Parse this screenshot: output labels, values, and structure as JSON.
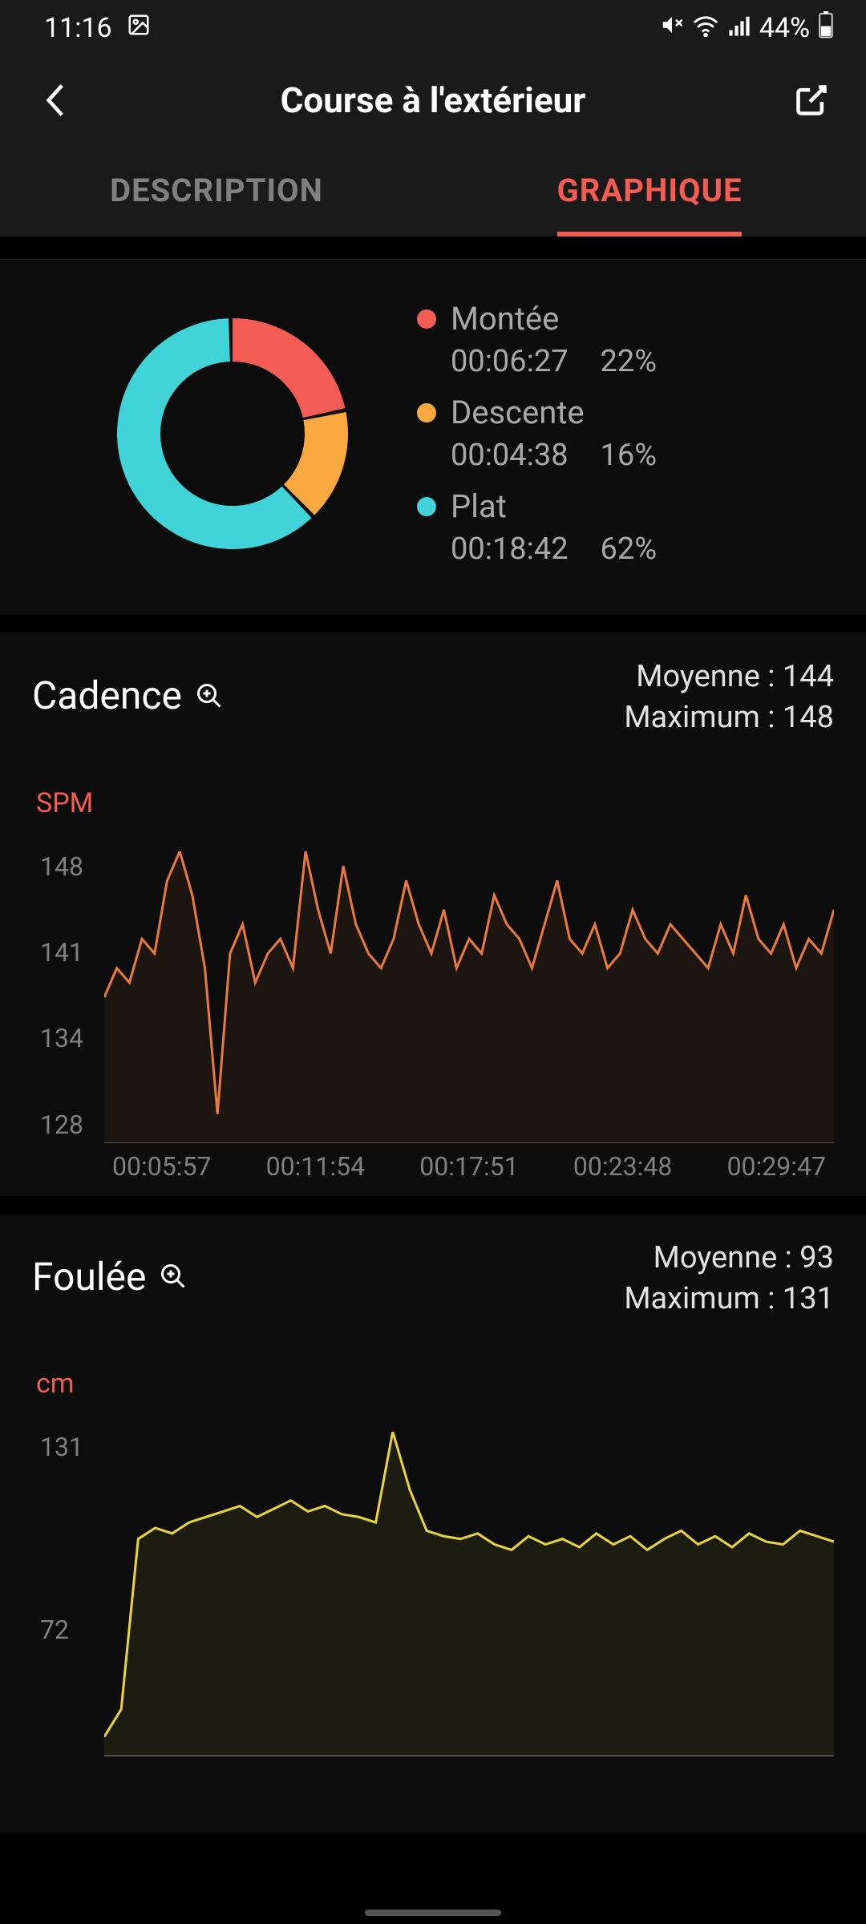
{
  "status_bar": {
    "time": "11:16",
    "battery": "44%"
  },
  "header": {
    "title": "Course à l'extérieur"
  },
  "tabs": {
    "description": "DESCRIPTION",
    "graphique": "GRAPHIQUE"
  },
  "colors": {
    "accent": "#f25c54",
    "montee": "#f25c54",
    "descente": "#f7a83e",
    "plat": "#40d3d8",
    "cadence_line": "#e87a3e",
    "foulee_line": "#e8d43e"
  },
  "donut": {
    "items": [
      {
        "name": "Montée",
        "time": "00:06:27",
        "pct": "22%",
        "value": 22,
        "color": "#f25c54"
      },
      {
        "name": "Descente",
        "time": "00:04:38",
        "pct": "16%",
        "value": 16,
        "color": "#f7a83e"
      },
      {
        "name": "Plat",
        "time": "00:18:42",
        "pct": "62%",
        "value": 62,
        "color": "#40d3d8"
      }
    ]
  },
  "cadence": {
    "title": "Cadence",
    "unit": "SPM",
    "avg_label": "Moyenne : 144",
    "max_label": "Maximum : 148",
    "ylabels": [
      "148",
      "141",
      "134",
      "128"
    ],
    "xlabels": [
      "00:05:57",
      "00:11:54",
      "00:17:51",
      "00:23:48",
      "00:29:47"
    ]
  },
  "foulee": {
    "title": "Foulée",
    "unit": "cm",
    "avg_label": "Moyenne : 93",
    "max_label": "Maximum : 131",
    "ylabels": [
      "131",
      "72"
    ]
  },
  "chart_data": [
    {
      "type": "pie",
      "title": "Terrain breakdown",
      "series": [
        {
          "name": "Montée",
          "value": 22,
          "time": "00:06:27"
        },
        {
          "name": "Descente",
          "value": 16,
          "time": "00:04:38"
        },
        {
          "name": "Plat",
          "value": 62,
          "time": "00:18:42"
        }
      ]
    },
    {
      "type": "line",
      "title": "Cadence",
      "ylabel": "SPM",
      "ylim": [
        128,
        148
      ],
      "xticks": [
        "00:05:57",
        "00:11:54",
        "00:17:51",
        "00:23:48",
        "00:29:47"
      ],
      "stats": {
        "mean": 144,
        "max": 148
      },
      "values": [
        138,
        140,
        139,
        142,
        141,
        146,
        148,
        145,
        140,
        130,
        141,
        143,
        139,
        141,
        142,
        140,
        148,
        144,
        141,
        147,
        143,
        141,
        140,
        142,
        146,
        143,
        141,
        144,
        140,
        142,
        141,
        145,
        143,
        142,
        140,
        143,
        146,
        142,
        141,
        143,
        140,
        141,
        144,
        142,
        141,
        143,
        142,
        141,
        140,
        143,
        141,
        145,
        142,
        141,
        143,
        140,
        142,
        141,
        144
      ]
    },
    {
      "type": "line",
      "title": "Foulée",
      "ylabel": "cm",
      "ylim": [
        13,
        131
      ],
      "stats": {
        "mean": 93,
        "max": 131
      },
      "values": [
        20,
        30,
        92,
        96,
        94,
        98,
        100,
        102,
        104,
        100,
        103,
        106,
        102,
        104,
        101,
        100,
        98,
        131,
        110,
        95,
        93,
        92,
        94,
        90,
        88,
        93,
        90,
        92,
        89,
        94,
        90,
        93,
        88,
        92,
        95,
        90,
        93,
        89,
        94,
        91,
        90,
        95,
        93,
        91
      ]
    }
  ]
}
